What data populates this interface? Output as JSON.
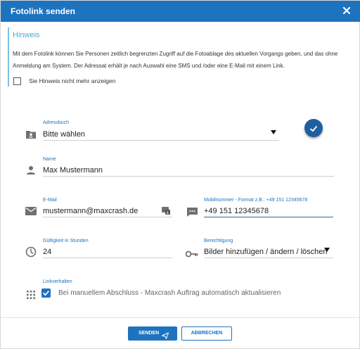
{
  "dialog": {
    "title": "Fotolink senden",
    "close_icon": "close-icon"
  },
  "hint": {
    "title": "Hinweis",
    "text": "Mit dem Fotolink können Sie Personen zeitlich begrenzten Zugriff auf die Fotoablage des aktuellen Vorgangs geben, und das ohne Anmeldung am System. Der Adressat erhält je nach Auswahl eine SMS und /oder eine E-Mail mit einem Link.",
    "checkbox_label": "Sie Hinweis nicht mehr anzeigen",
    "checkbox_checked": false
  },
  "form": {
    "addressbook": {
      "label": "Adressbuch",
      "value": "Bitte wählen",
      "icon": "contact-card-icon"
    },
    "name": {
      "label": "Name",
      "value": "Max Mustermann",
      "icon": "person-icon"
    },
    "email": {
      "label": "E-Mail",
      "value": "mustermann@maxcrash.de",
      "icon": "mail-icon",
      "suffix_icon": "sms-email-toggle-icon"
    },
    "mobile": {
      "label": "Mobilnummer - Format z.B.: +49 151 12345678",
      "value": "+49 151 12345678",
      "icon": "message-icon"
    },
    "validity": {
      "label": "Gültigkeit in Stunden",
      "value": "24",
      "icon": "clock-icon"
    },
    "permission": {
      "label": "Berechtigung",
      "value": "Bilder hinzufügen / ändern / löschen",
      "icon": "key-icon"
    },
    "link_behavior": {
      "label": "Linkverhalten",
      "checkbox_label": "Bei manuellem Abschluss - Maxcrash Auftrag automatisch aktualisieren",
      "checked": true,
      "icon": "apps-grid-icon"
    },
    "confirm_icon": "check-icon"
  },
  "footer": {
    "send_label": "SENDEN",
    "send_icon": "send-icon",
    "cancel_label": "ABBRECHEN"
  },
  "colors": {
    "primary": "#1e73be",
    "hint_accent": "#4aa8d8",
    "fab": "#1e5fa0"
  }
}
